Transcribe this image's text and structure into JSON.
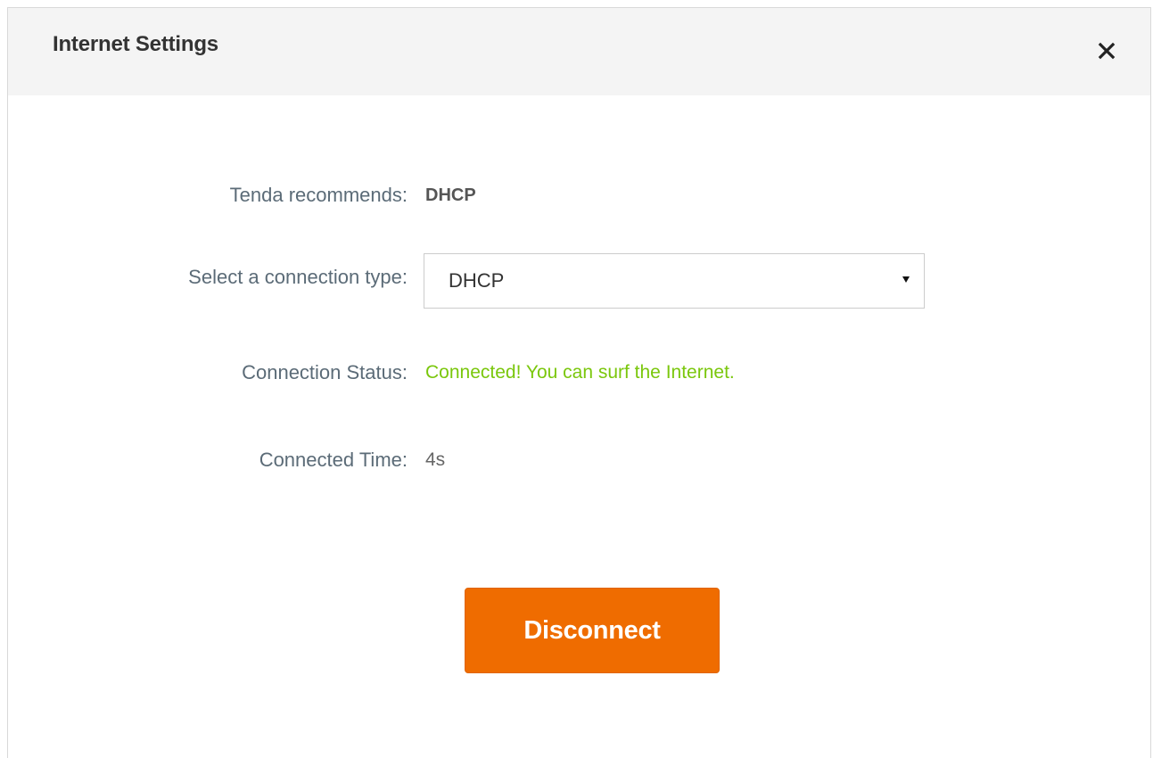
{
  "dialog": {
    "title": "Internet Settings",
    "close_icon": "close-icon"
  },
  "rows": {
    "recommend": {
      "label": "Tenda recommends:",
      "value": "DHCP"
    },
    "connection_type": {
      "label": "Select a connection type:",
      "selected": "DHCP",
      "arrow_icon": "caret-down-icon"
    },
    "status": {
      "label": "Connection Status:",
      "value": "Connected! You can surf the Internet."
    },
    "time": {
      "label": "Connected Time:",
      "value": "4s"
    }
  },
  "actions": {
    "disconnect_label": "Disconnect"
  },
  "colors": {
    "accent": "#ef6c00",
    "status_ok": "#7ac70c",
    "label_text": "#5b6b77",
    "header_bg": "#f4f4f4"
  }
}
